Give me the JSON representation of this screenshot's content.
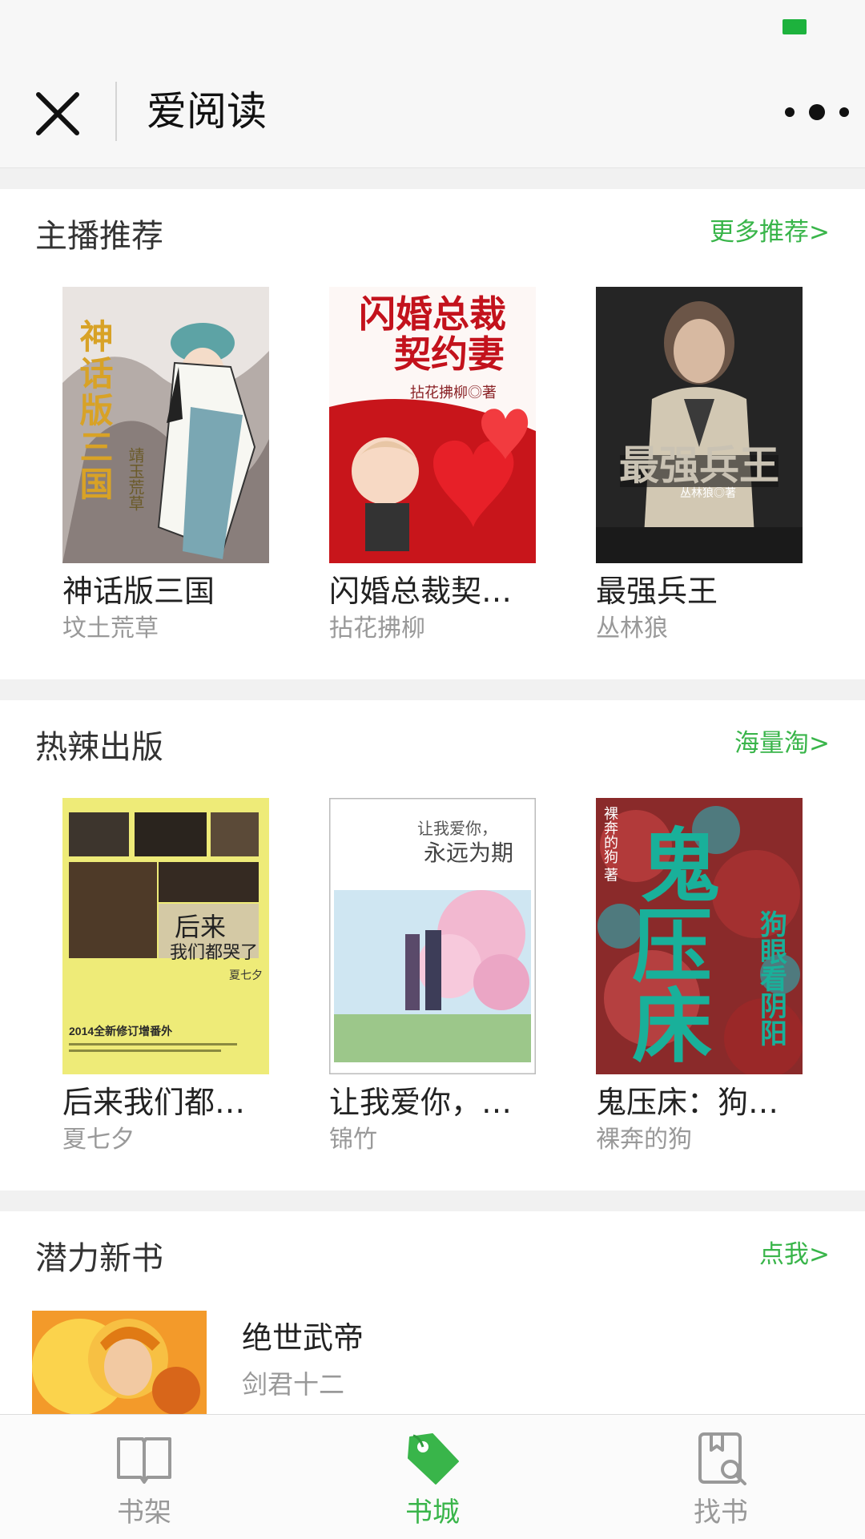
{
  "colors": {
    "accent": "#39b54a",
    "background": "#f1f1f1"
  },
  "header": {
    "title": "爱阅读",
    "close_icon": "close-icon",
    "more_icon": "more-icon"
  },
  "sections": [
    {
      "title": "主播推荐",
      "link": "更多推荐>",
      "books": [
        {
          "title": "神话版三国",
          "author": "坟土荒草"
        },
        {
          "title": "闪婚总裁契…",
          "author": "拈花拂柳"
        },
        {
          "title": "最强兵王",
          "author": "丛林狼"
        }
      ]
    },
    {
      "title": "热辣出版",
      "link": "海量淘>",
      "books": [
        {
          "title": "后来我们都…",
          "author": "夏七夕"
        },
        {
          "title": "让我爱你，…",
          "author": "锦竹"
        },
        {
          "title": "鬼压床：狗…",
          "author": "裸奔的狗"
        }
      ]
    },
    {
      "title": "潜力新书",
      "link": "点我>",
      "books": [
        {
          "title": "绝世武帝",
          "author": "剑君十二"
        }
      ]
    }
  ],
  "covers": {
    "c1": {
      "title": "神话版三国",
      "author": "靖玉荒草"
    },
    "c2": {
      "title1": "闪婚总裁",
      "title2": "契约妻",
      "author": "拈花拂柳◎著"
    },
    "c3": {
      "title": "最强兵王",
      "author": "丛林狼◎著"
    },
    "c4": {
      "title1": "后来",
      "title2": "我们都哭了",
      "author": "夏七夕",
      "edition": "2014全新修订增番外"
    },
    "c5": {
      "title1": "让我爱你，",
      "title2": "永远为期"
    },
    "c6": {
      "title1": "鬼",
      "title2": "压",
      "title3": "床",
      "subtitle": "狗眼看阴阳",
      "author": "裸奔的狗 著"
    }
  },
  "tabs": [
    {
      "label": "书架",
      "icon": "book-open-icon"
    },
    {
      "label": "书城",
      "icon": "tag-icon"
    },
    {
      "label": "找书",
      "icon": "book-search-icon"
    }
  ],
  "active_tab": "书城"
}
